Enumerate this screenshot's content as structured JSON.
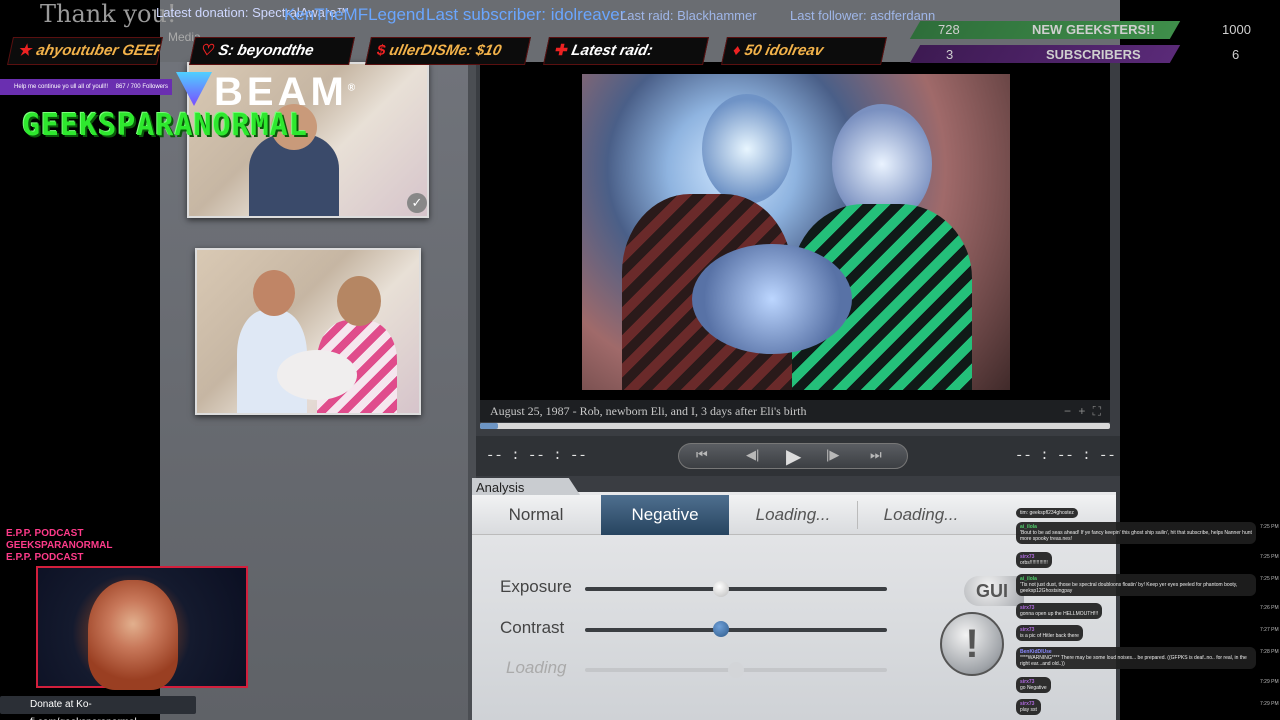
{
  "topbar": {
    "thank_you": "Thank you!",
    "ticker_1": "Latest donation: SpectralAware™",
    "ticker_2": "KenTheMFLegend",
    "ticker_3": "Last subscriber: idolreaver",
    "ticker_4": "Last raid: Blackhammer",
    "ticker_5": "Last follower: asdferdann",
    "ticker_6": "Media"
  },
  "alerts": [
    {
      "label": "ahyoutuber  GEEF"
    },
    {
      "label": "S: beyondthe"
    },
    {
      "label": "ullerDISMe: $10"
    },
    {
      "label": "Latest raid:"
    },
    {
      "label": "50  idolreav"
    }
  ],
  "goals": {
    "geeksters_current": "728",
    "geeksters_label": "NEW GEEKSTERS!!",
    "geeksters_target": "1000",
    "geeksters_percent": 72.8,
    "subs_current": "3",
    "subs_label": "SUBSCRIBERS",
    "subs_target": "6",
    "subs_percent": 50
  },
  "follower_bar": {
    "text": "Help me continue yo ull all of youll!!",
    "count": "867 / 700 Followers"
  },
  "brand": {
    "beam": "BEAM",
    "beam_mark": "®",
    "channel": "GEEKSPARANORMAL"
  },
  "viewer": {
    "caption": "August 25, 1987 - Rob, newborn Eli, and I, 3 days after Eli's birth",
    "time_left": "-- : -- : --",
    "time_right": "-- : -- : --"
  },
  "analysis": {
    "tab_label": "Analysis",
    "modes": [
      "Normal",
      "Negative",
      "Loading...",
      "Loading..."
    ],
    "active_mode": "Negative",
    "exposure_label": "Exposure",
    "contrast_label": "Contrast",
    "loading_label": "Loading",
    "gui_label": "GUI",
    "warn_label": "!",
    "exposure_level": 0.45,
    "contrast_level": 0.45,
    "loading_level": 0.5
  },
  "podcast": {
    "line1": "E.P.P. PODCAST",
    "line2": "GEEKSPARANORMAL",
    "line3": "E.P.P. PODCAST"
  },
  "kofi": {
    "text": "Donate at Ko-fi.com/geeksparanormal"
  },
  "chat": [
    {
      "name": "",
      "text": "tim: geekspfl234ghostez",
      "time": ""
    },
    {
      "name": "ai_ilola",
      "text": "'Bout to be ad seas ahead! If ye fancy keepin' this ghost ship sailin', hit that subscribe, helps Nanner hunt more spooky treas.nes!",
      "time": "7:25 PM"
    },
    {
      "name": "sirx73",
      "text": "orbs!!!!!!!!!!!!!",
      "time": "7:25 PM"
    },
    {
      "name": "ai_ilola",
      "text": "'Tis not just dust, those be spectral doubloons floatin' by! Keep yer eyes peeled for phantom booty, geeksp12Ghostsingpay",
      "time": "7:25 PM"
    },
    {
      "name": "sirx73",
      "text": "gonna open up the HELLMOUTH!!!",
      "time": "7:26 PM"
    },
    {
      "name": "sirx73",
      "text": "is a pic of Hitler back there",
      "time": "7:27 PM"
    },
    {
      "name": "BenKidDlUse",
      "text": "****WARNING**** There may be some loud noises... be prepared. ((GFPKS is deaf..no.. for real, in the right ear...and old..))",
      "time": "7:28 PM"
    },
    {
      "name": "sirx73",
      "text": "go Negative",
      "time": "7:29 PM"
    },
    {
      "name": "sirx73",
      "text": "play sst",
      "time": "7:29 PM"
    }
  ],
  "icons": {
    "close": "close-icon",
    "star": "star-icon",
    "heart": "heart-icon",
    "dollar": "dollar-icon",
    "raid": "raid-icon",
    "diamond": "diamond-icon",
    "prev": "skip-back-icon",
    "back": "step-back-icon",
    "play": "play-icon",
    "fwd": "step-forward-icon",
    "next": "skip-forward-icon",
    "check": "check-icon",
    "kofi": "kofi-cup-icon"
  },
  "colors": {
    "accent": "#27445f",
    "green_goal": "#3f8e4a",
    "purple_goal": "#5a2a78",
    "ticker": "#6aa6ff",
    "cam_border": "#d21f3c"
  }
}
